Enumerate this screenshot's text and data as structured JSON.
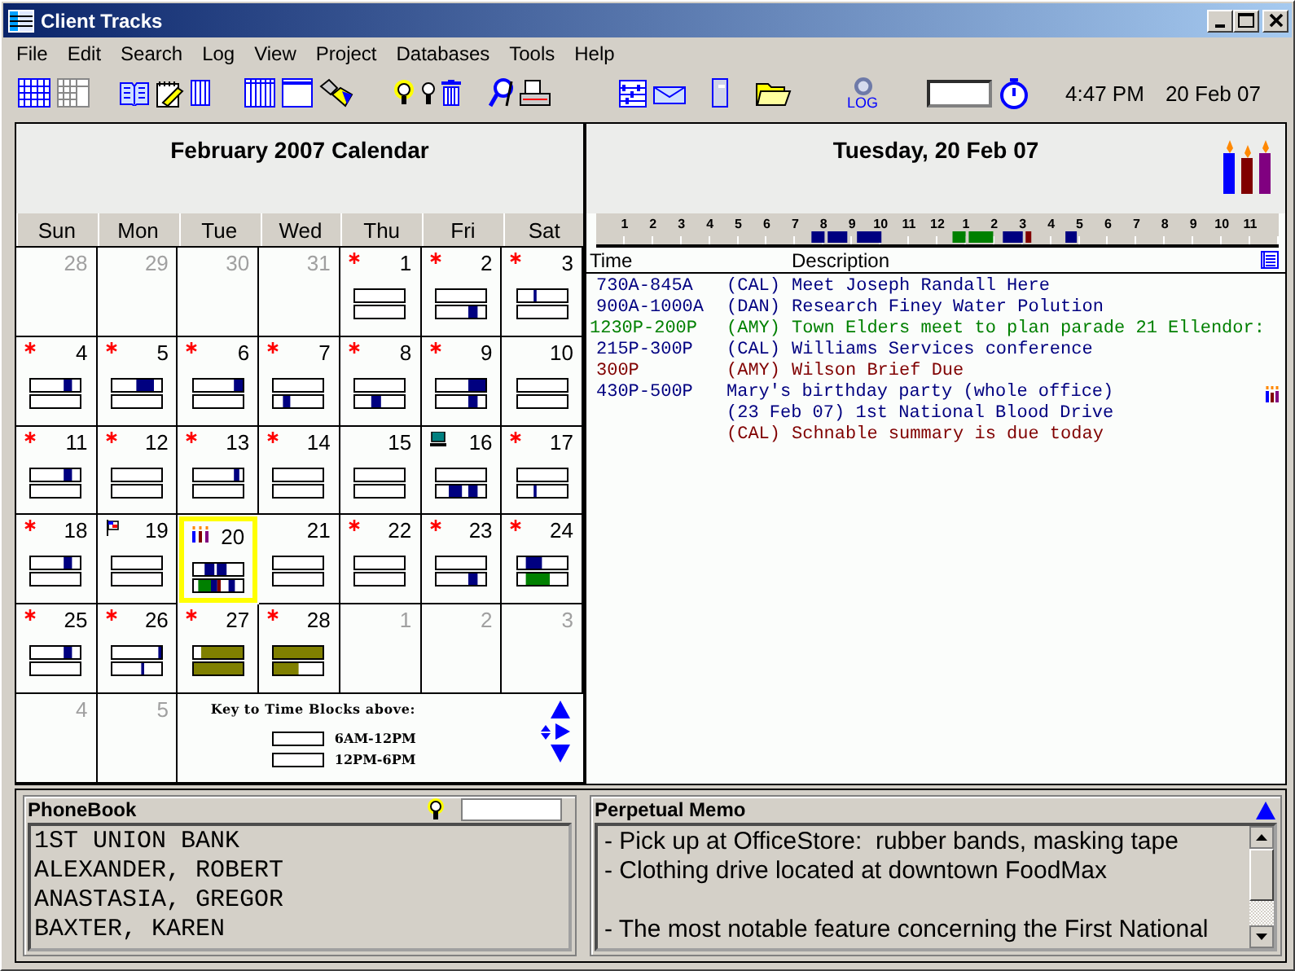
{
  "window": {
    "title": "Client Tracks"
  },
  "menu": [
    "File",
    "Edit",
    "Search",
    "Log",
    "View",
    "Project",
    "Databases",
    "Tools",
    "Help"
  ],
  "toolbar": {
    "log_label": "LOG",
    "time": "4:47 PM",
    "date": "20 Feb 07"
  },
  "calendar": {
    "title": "February 2007 Calendar",
    "weekdays": [
      "Sun",
      "Mon",
      "Tue",
      "Wed",
      "Thu",
      "Fri",
      "Sat"
    ],
    "days": [
      {
        "day": "28",
        "kind": "plain",
        "muted": true,
        "selected": false
      },
      {
        "day": "29",
        "kind": "plain",
        "muted": true,
        "selected": false
      },
      {
        "day": "30",
        "kind": "plain",
        "muted": true,
        "selected": false
      },
      {
        "day": "31",
        "kind": "plain",
        "muted": true,
        "selected": false
      },
      {
        "day": "1",
        "kind": "note",
        "muted": false,
        "selected": false
      },
      {
        "day": "2",
        "kind": "note",
        "muted": false,
        "selected": false
      },
      {
        "day": "3",
        "kind": "note",
        "muted": false,
        "selected": false
      },
      {
        "day": "4",
        "kind": "note",
        "muted": false,
        "selected": false
      },
      {
        "day": "5",
        "kind": "note",
        "muted": false,
        "selected": false
      },
      {
        "day": "6",
        "kind": "note",
        "muted": false,
        "selected": false
      },
      {
        "day": "7",
        "kind": "note",
        "muted": false,
        "selected": false
      },
      {
        "day": "8",
        "kind": "note",
        "muted": false,
        "selected": false
      },
      {
        "day": "9",
        "kind": "note",
        "muted": false,
        "selected": false
      },
      {
        "day": "10",
        "kind": "plain",
        "muted": false,
        "selected": false
      },
      {
        "day": "11",
        "kind": "note",
        "muted": false,
        "selected": false
      },
      {
        "day": "12",
        "kind": "note",
        "muted": false,
        "selected": false
      },
      {
        "day": "13",
        "kind": "note",
        "muted": false,
        "selected": false
      },
      {
        "day": "14",
        "kind": "note",
        "muted": false,
        "selected": false
      },
      {
        "day": "15",
        "kind": "plain",
        "muted": false,
        "selected": false
      },
      {
        "day": "16",
        "kind": "computer",
        "muted": false,
        "selected": false
      },
      {
        "day": "17",
        "kind": "note",
        "muted": false,
        "selected": false
      },
      {
        "day": "18",
        "kind": "note",
        "muted": false,
        "selected": false
      },
      {
        "day": "19",
        "kind": "flag",
        "muted": false,
        "selected": false
      },
      {
        "day": "20",
        "kind": "birthday",
        "muted": false,
        "selected": true
      },
      {
        "day": "21",
        "kind": "plain",
        "muted": false,
        "selected": false
      },
      {
        "day": "22",
        "kind": "note",
        "muted": false,
        "selected": false
      },
      {
        "day": "23",
        "kind": "note",
        "muted": false,
        "selected": false
      },
      {
        "day": "24",
        "kind": "note",
        "muted": false,
        "selected": false
      },
      {
        "day": "25",
        "kind": "note",
        "muted": false,
        "selected": false
      },
      {
        "day": "26",
        "kind": "note",
        "muted": false,
        "selected": false
      },
      {
        "day": "27",
        "kind": "note",
        "muted": false,
        "selected": false
      },
      {
        "day": "28",
        "kind": "note",
        "muted": false,
        "selected": false
      },
      {
        "day": "1",
        "kind": "plain",
        "muted": true,
        "selected": false
      },
      {
        "day": "2",
        "kind": "plain",
        "muted": true,
        "selected": false
      },
      {
        "day": "3",
        "kind": "plain",
        "muted": true,
        "selected": false
      },
      {
        "day": "4",
        "kind": "plain",
        "muted": true,
        "selected": false
      },
      {
        "day": "5",
        "kind": "plain",
        "muted": true,
        "selected": false
      }
    ],
    "key": {
      "title": "Key to Time Blocks above:",
      "blocks": [
        "6AM-12PM",
        "12PM-6PM"
      ]
    }
  },
  "day_view": {
    "title": "Tuesday, 20 Feb 07",
    "hours": [
      "1",
      "2",
      "3",
      "4",
      "5",
      "6",
      "7",
      "8",
      "9",
      "10",
      "11",
      "12",
      "1",
      "2",
      "3",
      "4",
      "5",
      "6",
      "7",
      "8",
      "9",
      "10",
      "11"
    ],
    "columns": [
      "Time",
      "Description"
    ],
    "events": [
      {
        "kind": "appointment",
        "time": "730A-845A",
        "tag": "(CAL)",
        "description": "Meet Joseph Randall Here",
        "color": "#000080"
      },
      {
        "kind": "appointment",
        "time": "900A-1000A",
        "tag": "(DAN)",
        "description": "Research Finey Water Polution",
        "color": "#000080"
      },
      {
        "kind": "appointment",
        "time": "1230P-200P",
        "tag": "(AMY)",
        "description": "Town Elders meet to plan parade 21 Ellendor:",
        "color": "#008000"
      },
      {
        "kind": "appointment",
        "time": "215P-300P",
        "tag": "(CAL)",
        "description": "Williams Services conference",
        "color": "#000080"
      },
      {
        "kind": "appointment",
        "time": "300P",
        "tag": "(AMY)",
        "description": "Wilson Brief Due",
        "color": "#800000"
      },
      {
        "kind": "birthday",
        "time": "430P-500P",
        "description": "Mary's birthday party (whole office)",
        "color": "#000080"
      },
      {
        "kind": "appointment",
        "description": "(23 Feb 07) 1st National Blood Drive",
        "color": "#000080"
      },
      {
        "kind": "appointment",
        "tag": "(CAL)",
        "description": "Schnable summary is due today",
        "color": "#800000"
      }
    ]
  },
  "phonebook": {
    "title": "PhoneBook",
    "entries": [
      "1ST UNION BANK",
      "ALEXANDER, ROBERT",
      "ANASTASIA, GREGOR",
      "BAXTER, KAREN"
    ]
  },
  "memo": {
    "title": "Perpetual Memo",
    "paragraphs": [
      [
        "- Pick up at OfficeStore:  rubber bands, masking tape",
        "- Clothing drive located at downtown FoodMax"
      ],
      [
        "- The most notable feature concerning the First National"
      ]
    ]
  }
}
